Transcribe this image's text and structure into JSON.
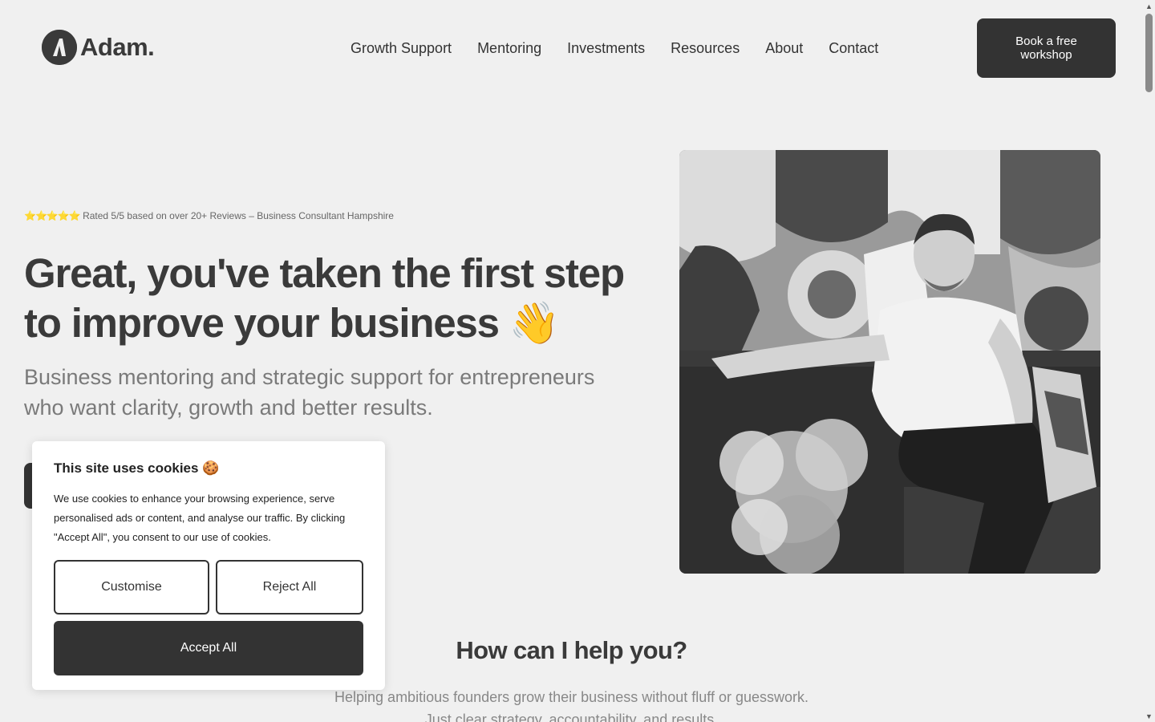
{
  "brand": {
    "name": "Adam."
  },
  "nav": {
    "items": [
      {
        "label": "Growth Support"
      },
      {
        "label": "Mentoring"
      },
      {
        "label": "Investments"
      },
      {
        "label": "Resources"
      },
      {
        "label": "About"
      },
      {
        "label": "Contact"
      }
    ],
    "cta_label": "Book a free workshop"
  },
  "hero": {
    "rating_stars": "⭐⭐⭐⭐⭐",
    "rating_text": "Rated 5/5 based on over 20+ Reviews – Business Consultant Hampshire",
    "title": "Great, you've taken the first step to improve your business",
    "title_glyph": "👋",
    "subtitle": "Business mentoring and strategic support for entrepreneurs who want clarity, growth and better results."
  },
  "help": {
    "title": "How can I help you?",
    "line1": "Helping ambitious founders grow their business without fluff or guesswork.",
    "line2": "Just clear strategy, accountability, and results."
  },
  "cookie": {
    "title": "This site uses cookies",
    "title_glyph": "🍪",
    "text": "We use cookies to enhance your browsing experience, serve personalised ads or content, and analyse our traffic. By clicking \"Accept All\", you consent to our use of cookies.",
    "customise_label": "Customise",
    "reject_label": "Reject All",
    "accept_label": "Accept All"
  },
  "colors": {
    "background": "#f0f0f0",
    "primary_dark": "#333333",
    "text_muted": "#7a7a7a"
  },
  "icons": {
    "logo": "logo-a-mark-icon",
    "scroll_up": "chevron-up-icon",
    "scroll_down": "chevron-down-icon"
  }
}
